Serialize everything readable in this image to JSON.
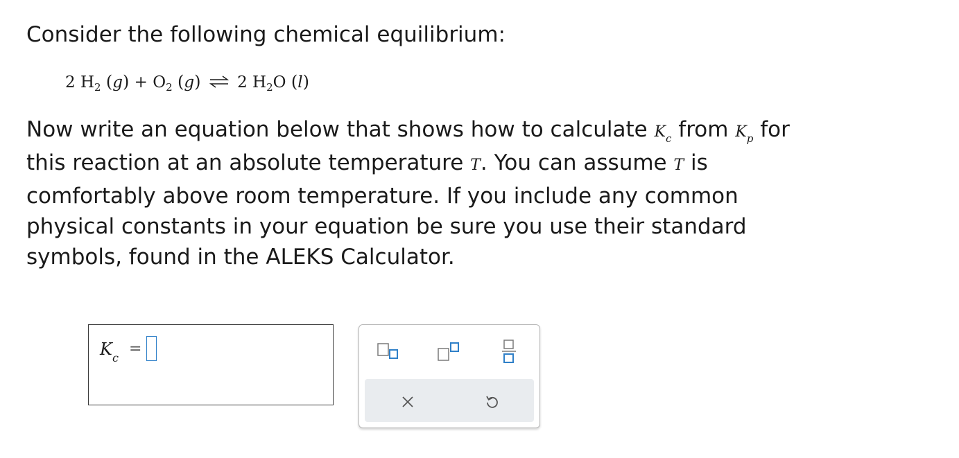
{
  "intro": "Consider the following chemical equilibrium:",
  "reaction": {
    "coef1": "2",
    "h": "H",
    "sub2": "2",
    "state_g": "g",
    "plus": "+",
    "o": "O",
    "coef3": "2",
    "water": "H",
    "water_o": "O",
    "state_l": "l"
  },
  "question": {
    "line1_a": "Now write an equation below that shows how to calculate",
    "kc_var": "K",
    "kc_sub": "c",
    "line1_b": "from",
    "kp_var": "K",
    "kp_sub": "p",
    "line1_c": "for",
    "line2_a": "this reaction at an absolute temperature",
    "t_var": "T",
    "line2_b": ". You can assume",
    "line2_c": "is",
    "line3": "comfortably above room temperature. If you include any common",
    "line4": "physical constants in your equation be sure you use their standard",
    "line5": "symbols, found in the ALEKS Calculator."
  },
  "answer": {
    "lhs_var": "K",
    "lhs_sub": "c",
    "equals": "="
  },
  "palette": {
    "icons": [
      "subscript-icon",
      "superscript-icon",
      "fraction-icon",
      "clear-icon",
      "undo-icon"
    ],
    "accent_color": "#2f80c8",
    "tray_color": "#e9ecef"
  }
}
